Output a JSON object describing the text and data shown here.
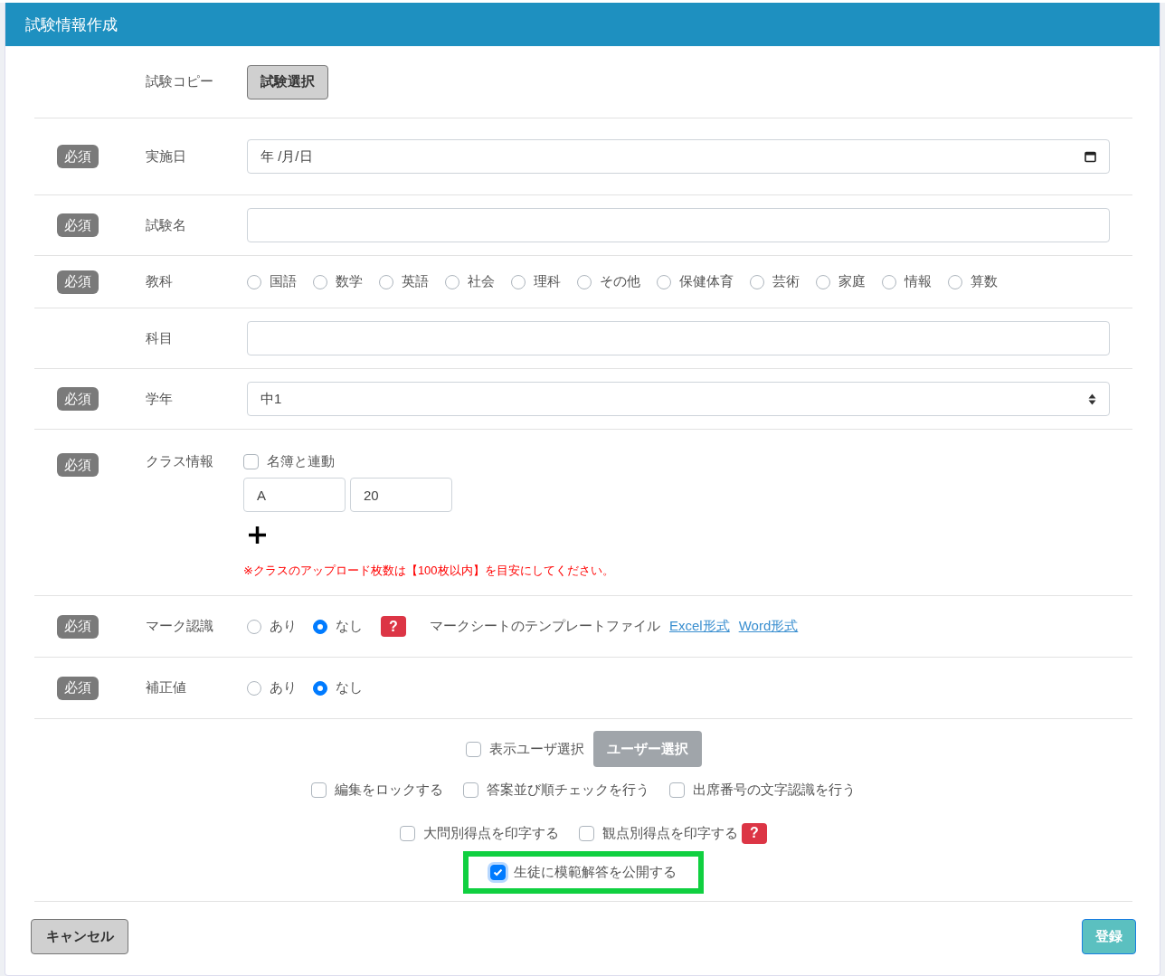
{
  "header": {
    "title": "試験情報作成"
  },
  "rows": [
    {
      "kind": "button",
      "label": "試験コピー",
      "button": "試験選択"
    },
    {
      "kind": "date",
      "badge": "必須",
      "label": "実施日",
      "display": "年 /月/日"
    },
    {
      "kind": "text",
      "badge": "必須",
      "label": "試験名"
    },
    {
      "kind": "radio",
      "badge": "必須",
      "label": "教科",
      "options": [
        {
          "label": "国語",
          "selected": false
        },
        {
          "label": "数学",
          "selected": false
        },
        {
          "label": "英語",
          "selected": false
        },
        {
          "label": "社会",
          "selected": false
        },
        {
          "label": "理科",
          "selected": false
        },
        {
          "label": "その他",
          "selected": false
        },
        {
          "label": "保健体育",
          "selected": false
        },
        {
          "label": "芸術",
          "selected": false
        },
        {
          "label": "家庭",
          "selected": false
        },
        {
          "label": "情報",
          "selected": false
        },
        {
          "label": "算数",
          "selected": false
        }
      ]
    },
    {
      "kind": "text",
      "label": "科目"
    },
    {
      "kind": "select",
      "badge": "必須",
      "label": "学年",
      "value": "中1"
    },
    {
      "kind": "class",
      "badge": "必須",
      "label": "クラス情報",
      "link_checkbox": {
        "label": "名簿と連動",
        "checked": false
      },
      "class_value": "A",
      "count_value": "20",
      "note": "※クラスのアップロード枚数は【100枚以内】を目安にしてください。"
    },
    {
      "kind": "radio",
      "badge": "必須",
      "label": "マーク認識",
      "options": [
        {
          "label": "あり",
          "selected": false
        },
        {
          "label": "なし",
          "selected": true
        }
      ],
      "help": "?",
      "template_label": "マークシートのテンプレートファイル",
      "links": [
        "Excel形式",
        "Word形式"
      ]
    },
    {
      "kind": "radio",
      "badge": "必須",
      "label": "補正値",
      "options": [
        {
          "label": "あり",
          "selected": false
        },
        {
          "label": "なし",
          "selected": true
        }
      ]
    }
  ],
  "user_select": {
    "label": "表示ユーザ選択",
    "checked": false,
    "button": "ユーザー選択"
  },
  "option_lines": [
    {
      "items": [
        {
          "kind": "checkbox",
          "label": "編集をロックする",
          "checked": false,
          "highlighted": false
        },
        {
          "kind": "checkbox",
          "label": "答案並び順チェックを行う",
          "checked": false,
          "highlighted": false
        },
        {
          "kind": "checkbox",
          "label": "出席番号の文字認識を行う",
          "checked": false,
          "highlighted": false
        }
      ]
    },
    {
      "items": [
        {
          "kind": "checkbox",
          "label": "大問別得点を印字する",
          "checked": false,
          "highlighted": false
        },
        {
          "kind": "checkbox",
          "label": "観点別得点を印字する",
          "checked": false,
          "highlighted": false
        },
        {
          "kind": "help",
          "label": "?"
        }
      ]
    },
    {
      "items": [
        {
          "kind": "checkbox",
          "label": "生徒に模範解答を公開する",
          "checked": true,
          "highlighted": true
        }
      ]
    }
  ],
  "footer": {
    "cancel": "キャンセル",
    "submit": "登録"
  }
}
